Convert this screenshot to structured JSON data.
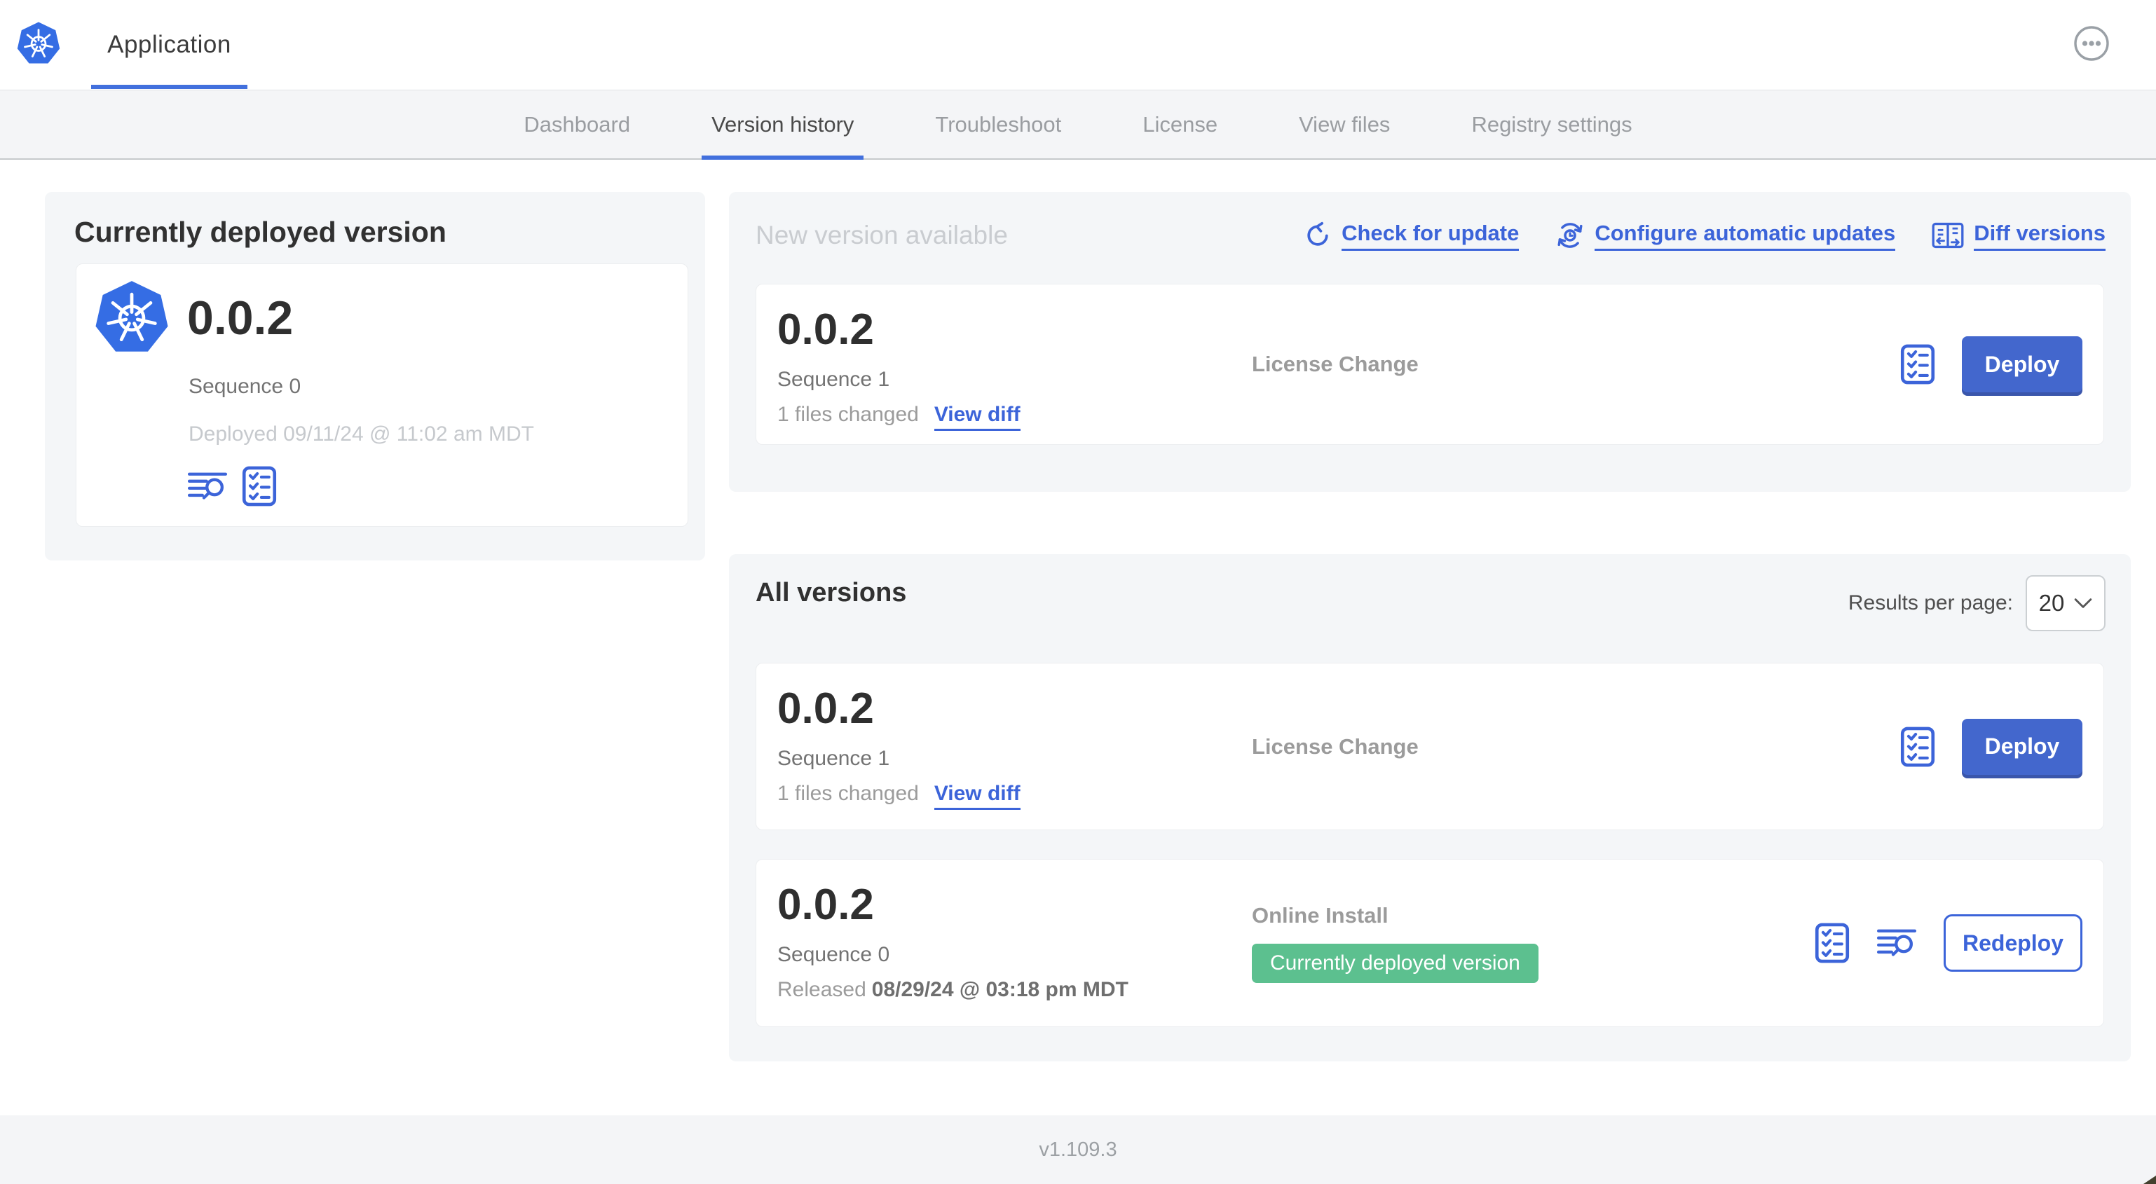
{
  "colors": {
    "accent_blue": "#3c64d9",
    "button_blue": "#4367cd",
    "logo_blue": "#356de4",
    "badge_green": "#5cc08f",
    "section_bg": "#f4f6f8",
    "nav_bg": "#f4f5f7"
  },
  "header": {
    "logo_icon": "kubernetes-logo-icon",
    "app_tab_label": "Application",
    "menu_icon": "ellipsis-circle-icon"
  },
  "nav": {
    "active_tab": "Version history",
    "tabs": [
      "Dashboard",
      "Version history",
      "Troubleshoot",
      "License",
      "View files",
      "Registry settings"
    ]
  },
  "currently_deployed": {
    "title": "Currently deployed version",
    "version": "0.0.2",
    "sequence": "Sequence 0",
    "deployed_at": "Deployed 09/11/24 @ 11:02 am MDT",
    "icons": [
      "logs-icon",
      "checklist-icon"
    ]
  },
  "new_version": {
    "title": "New version available",
    "actions": [
      {
        "label": "Check for update",
        "icon": "refresh-icon"
      },
      {
        "label": "Configure automatic updates",
        "icon": "sync-clock-icon"
      },
      {
        "label": "Diff versions",
        "icon": "diff-icon"
      }
    ],
    "card": {
      "version": "0.0.2",
      "sequence": "Sequence 1",
      "files_changed": "1 files changed",
      "view_diff_label": "View diff",
      "source": "License Change",
      "deploy_label": "Deploy"
    }
  },
  "all_versions": {
    "title": "All versions",
    "results_per_page_label": "Results per page:",
    "results_per_page_value": "20",
    "rows": [
      {
        "version": "0.0.2",
        "sequence": "Sequence 1",
        "files_changed": "1 files changed",
        "view_diff_label": "View diff",
        "source": "License Change",
        "action_label": "Deploy"
      },
      {
        "version": "0.0.2",
        "sequence": "Sequence 0",
        "released_prefix": "Released",
        "released_date": "08/29/24 @ 03:18 pm MDT",
        "source": "Online Install",
        "badge": "Currently deployed version",
        "action_label": "Redeploy"
      }
    ]
  },
  "footer": {
    "app_version": "v1.109.3"
  }
}
